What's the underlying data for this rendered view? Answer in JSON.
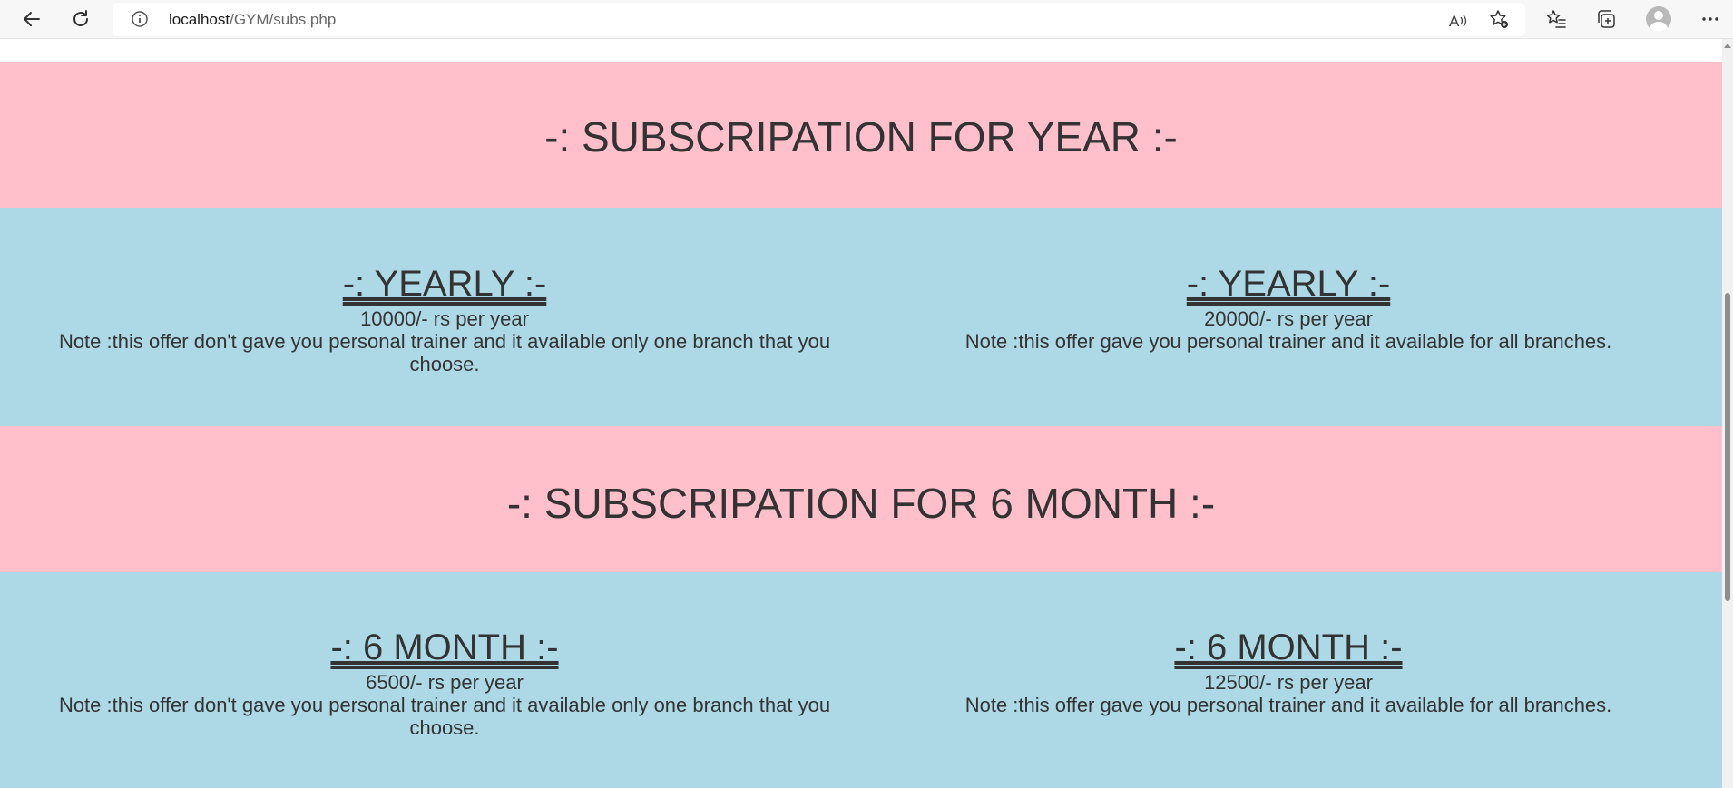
{
  "browser": {
    "url_host": "localhost",
    "url_path": "/GYM/subs.php"
  },
  "sections": [
    {
      "title": "-: SUBSCRIPATION FOR YEAR :-",
      "cards": [
        {
          "plan": "-: YEARLY :-",
          "price": "10000/- rs per year",
          "note": "Note :this offer don't gave you personal trainer and it available only one branch that you choose."
        },
        {
          "plan": "-: YEARLY :-",
          "price": "20000/- rs per year",
          "note": "Note :this offer gave you personal trainer and it available for all branches."
        }
      ]
    },
    {
      "title": "-: SUBSCRIPATION FOR 6 MONTH :-",
      "cards": [
        {
          "plan": "-: 6 MONTH :-",
          "price": "6500/- rs per year",
          "note": "Note :this offer don't gave you personal trainer and it available only one branch that you choose."
        },
        {
          "plan": "-: 6 MONTH :-",
          "price": "12500/- rs per year",
          "note": "Note :this offer gave you personal trainer and it available for all branches."
        }
      ]
    }
  ],
  "colors": {
    "section_header_bg": "#ffc0cb",
    "section_body_bg": "#add8e6",
    "text": "#333333"
  },
  "icons": {
    "back": "back-arrow-icon",
    "refresh": "refresh-icon",
    "info": "site-info-icon",
    "read_aloud": "read-aloud-icon",
    "add_favorite": "add-favorite-icon",
    "favorites": "favorites-icon",
    "collections": "collections-icon",
    "profile": "profile-avatar-icon",
    "more": "more-menu-icon"
  }
}
